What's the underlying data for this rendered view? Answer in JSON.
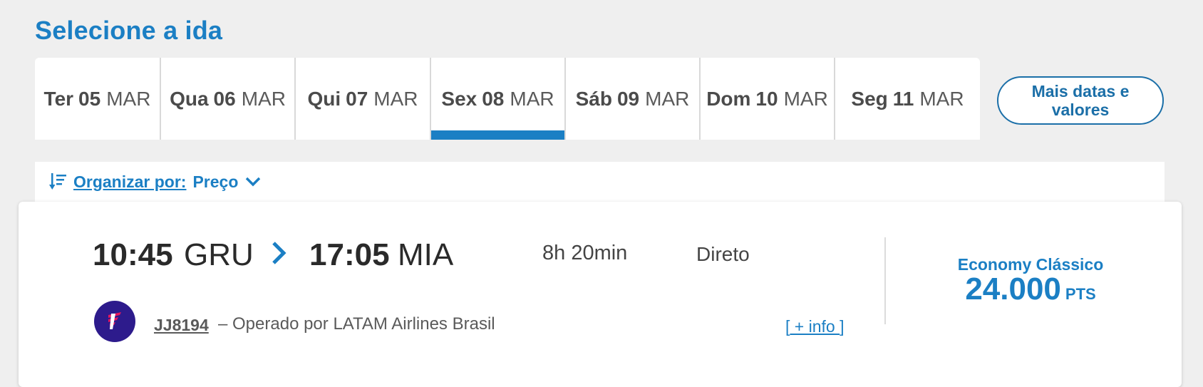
{
  "page_title": "Selecione a ida",
  "date_tabs": [
    {
      "weekday": "Ter",
      "day": "05",
      "month": "MAR",
      "active": false
    },
    {
      "weekday": "Qua",
      "day": "06",
      "month": "MAR",
      "active": false
    },
    {
      "weekday": "Qui",
      "day": "07",
      "month": "MAR",
      "active": false
    },
    {
      "weekday": "Sex",
      "day": "08",
      "month": "MAR",
      "active": true
    },
    {
      "weekday": "Sáb",
      "day": "09",
      "month": "MAR",
      "active": false
    },
    {
      "weekday": "Dom",
      "day": "10",
      "month": "MAR",
      "active": false
    },
    {
      "weekday": "Seg",
      "day": "11",
      "month": "MAR",
      "active": false
    }
  ],
  "more_dates_label": "Mais datas e valores",
  "sort": {
    "label": "Organizar por:",
    "value": "Preço"
  },
  "flight": {
    "departure_time": "10:45",
    "departure_airport": "GRU",
    "arrival_time": "17:05",
    "arrival_airport": "MIA",
    "duration": "8h 20min",
    "stops": "Direto",
    "flight_number": "JJ8194",
    "operated_by": "– Operado por LATAM Airlines Brasil",
    "more_info_open": "[",
    "more_info_label": " + info ",
    "more_info_close": "]",
    "cabin": "Economy Clássico",
    "price_amount": "24.000",
    "price_unit": "PTS"
  },
  "colors": {
    "accent": "#1b7fc4",
    "background": "#efefef",
    "airline_logo": "#2d1b8c"
  }
}
